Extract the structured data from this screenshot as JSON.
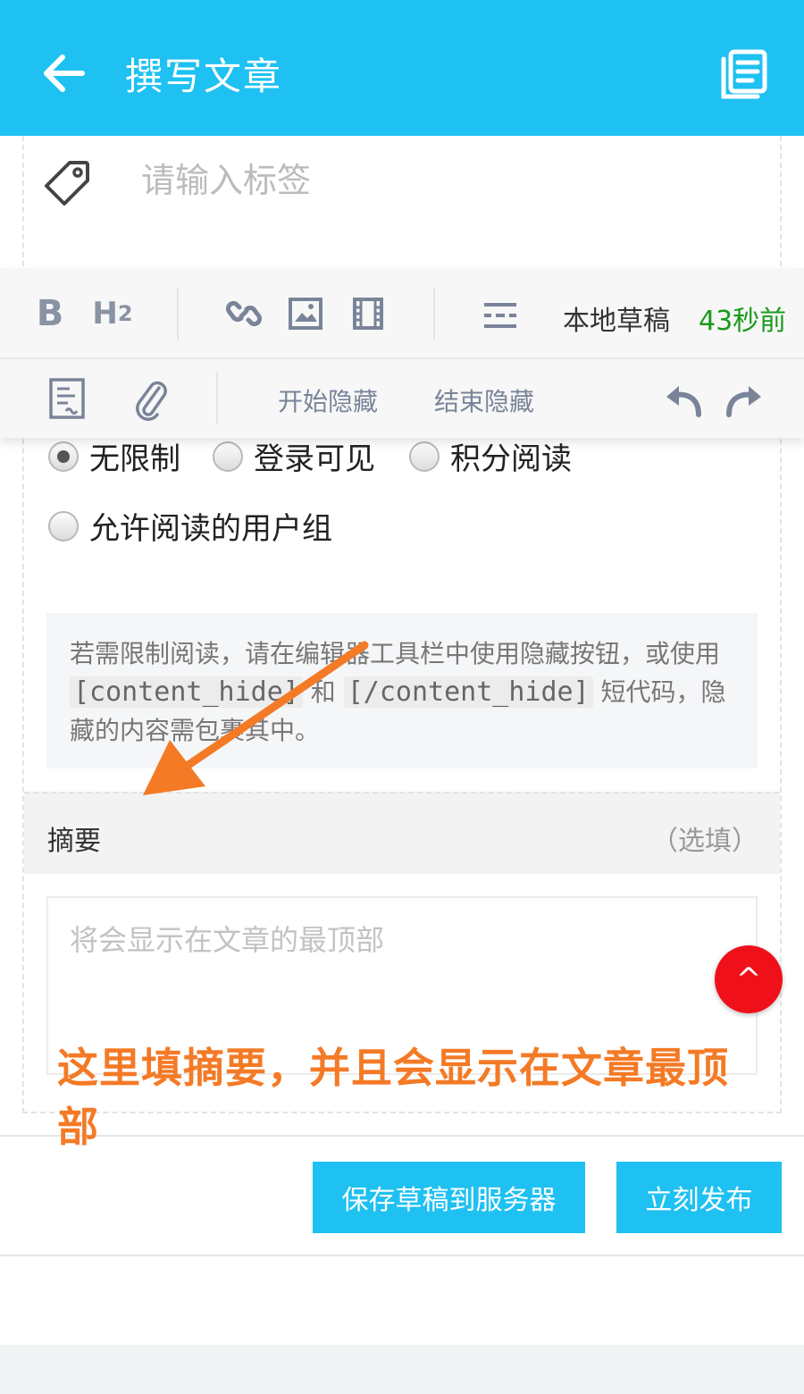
{
  "appbar": {
    "title": "撰写文章",
    "back_icon": "arrow-left-icon",
    "doc_icon": "document-list-icon"
  },
  "tags": {
    "placeholder": "请输入标签",
    "icon": "tag-icon"
  },
  "toolbar": {
    "bold_label": "B",
    "h2_label": "H",
    "h2_sub": "2",
    "local_draft": "本地草稿",
    "draft_time": "43秒前",
    "hide_start": "开始隐藏",
    "hide_end": "结束隐藏"
  },
  "access": {
    "options": [
      "无限制",
      "登录可见",
      "积分阅读",
      "允许阅读的用户组"
    ],
    "selected": "无限制"
  },
  "info": {
    "text_a": "若需限制阅读，请在编辑器工具栏中使用隐藏按钮，或使用",
    "code_open": "[content_hide]",
    "text_b": "和",
    "code_close": "[/content_hide]",
    "text_c": "短代码，隐藏的内容需包裹其中。"
  },
  "summary": {
    "title": "摘要",
    "optional": "（选填）",
    "placeholder": "将会显示在文章的最顶部"
  },
  "scroll_top_label": "^",
  "annotation": {
    "text": "这里填摘要，并且会显示在文章最顶部",
    "color": "#f47a26"
  },
  "actions": {
    "save": "保存草稿到服务器",
    "publish": "立刻发布"
  },
  "colors": {
    "primary": "#1ec1f1",
    "draft_time": "#1a9a1a",
    "scroll_top": "#f0101a"
  }
}
